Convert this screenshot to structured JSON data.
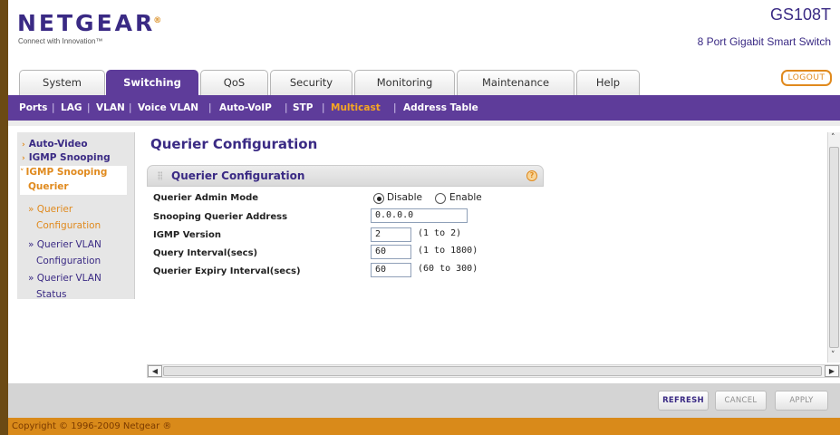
{
  "header": {
    "logo": "NETGEAR",
    "logo_mark": "®",
    "tagline": "Connect with Innovation™",
    "product_name": "GS108T",
    "product_desc": "8 Port Gigabit Smart Switch"
  },
  "tabs": [
    "System",
    "Switching",
    "QoS",
    "Security",
    "Monitoring",
    "Maintenance",
    "Help"
  ],
  "logout_label": "LOGOUT",
  "subnav": [
    "Ports",
    "LAG",
    "VLAN",
    "Voice VLAN",
    "Auto-VoIP",
    "STP",
    "Multicast",
    "Address Table"
  ],
  "sidebar": {
    "auto_video": "Auto-Video",
    "igmp_snooping": "IGMP Snooping",
    "igmp_querier_line1": "IGMP Snooping",
    "igmp_querier_line2": "Querier",
    "sub1_line1": "» Querier",
    "sub1_line2": "Configuration",
    "sub2_line1": "» Querier VLAN",
    "sub2_line2": "Configuration",
    "sub3_line1": "» Querier VLAN",
    "sub3_line2": "Status"
  },
  "page_title": "Querier Configuration",
  "panel_title": "Querier Configuration",
  "help_glyph": "?",
  "form": {
    "admin_mode_label": "Querier Admin Mode",
    "disable_label": "Disable",
    "enable_label": "Enable",
    "snooping_address_label": "Snooping Querier Address",
    "snooping_address_value": "0.0.0.0",
    "igmp_version_label": "IGMP Version",
    "igmp_version_value": "2",
    "igmp_version_range": "(1 to 2)",
    "query_interval_label": "Query Interval(secs)",
    "query_interval_value": "60",
    "query_interval_range": "(1 to 1800)",
    "expiry_interval_label": "Querier Expiry Interval(secs)",
    "expiry_interval_value": "60",
    "expiry_interval_range": "(60 to 300)"
  },
  "buttons": {
    "refresh": "REFRESH",
    "cancel": "CANCEL",
    "apply": "APPLY"
  },
  "copyright": "Copyright © 1996-2009 Netgear ®"
}
